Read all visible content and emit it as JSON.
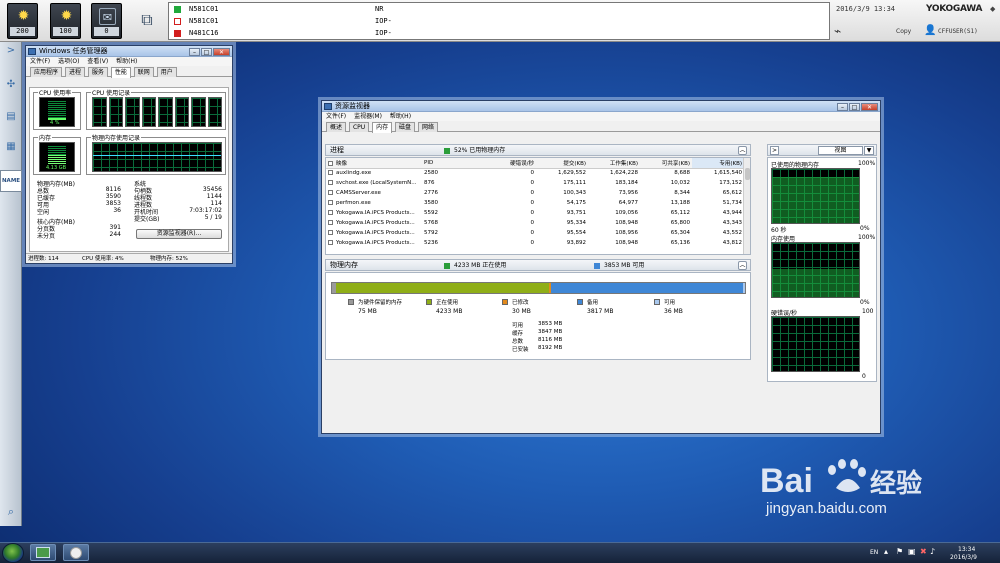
{
  "topbar": {
    "buttons": [
      {
        "icon": "sun-alarm-icon",
        "count": "200"
      },
      {
        "icon": "sun-alarm-icon",
        "count": "100"
      },
      {
        "icon": "message-icon",
        "count": "0"
      }
    ],
    "alarms": [
      {
        "tag": "N581C01",
        "value": "NR",
        "color": "#1fa83a"
      },
      {
        "tag": "N581C01",
        "value": "IOP-",
        "color": "#d21e1e"
      },
      {
        "tag": "N481C16",
        "value": "IOP-",
        "color": "#d21e1e"
      }
    ],
    "datetime": "2016/3/9  13:34",
    "brand": "YOKOGAWA",
    "copy_label": "Copy",
    "user": "CFFUSER(S1)"
  },
  "sidebar": {
    "name_label": "NAME"
  },
  "taskmgr": {
    "title": "Windows 任务管理器",
    "menu": [
      "文件(F)",
      "选项(O)",
      "查看(V)",
      "帮助(H)"
    ],
    "tabs": [
      "应用程序",
      "进程",
      "服务",
      "性能",
      "联网",
      "用户"
    ],
    "active_tab": 3,
    "cpu_usage_label": "CPU 使用率",
    "cpu_usage_value": "4 %",
    "cpu_history_label": "CPU 使用记录",
    "memory_label": "内存",
    "memory_value": "4.13 GB",
    "mem_history_label": "物理内存使用记录",
    "physical_label": "物理内存(MB)",
    "physical": [
      {
        "k": "总数",
        "v": "8116"
      },
      {
        "k": "已缓存",
        "v": "3590"
      },
      {
        "k": "可用",
        "v": "3853"
      },
      {
        "k": "空闲",
        "v": "36"
      }
    ],
    "kernel_label": "核心内存(MB)",
    "kernel": [
      {
        "k": "分页数",
        "v": "391"
      },
      {
        "k": "未分页",
        "v": "244"
      }
    ],
    "system_label": "系统",
    "system": [
      {
        "k": "句柄数",
        "v": "35456"
      },
      {
        "k": "线程数",
        "v": "1144"
      },
      {
        "k": "进程数",
        "v": "114"
      },
      {
        "k": "开机时间",
        "v": "7:03:17:02"
      },
      {
        "k": "提交(GB)",
        "v": "5 / 19"
      }
    ],
    "resmon_button": "资源监视器(R)...",
    "status": [
      "进程数: 114",
      "CPU 使用率: 4%",
      "物理内存: 52%"
    ]
  },
  "resmon": {
    "title": "资源监视器",
    "menu": [
      "文件(F)",
      "监视器(M)",
      "帮助(H)"
    ],
    "tabs": [
      "概述",
      "CPU",
      "内存",
      "磁盘",
      "网络"
    ],
    "active_tab": 2,
    "process_section": "进程",
    "process_summary": "52% 已用物理内存",
    "columns": [
      "映像",
      "PID",
      "硬错误/秒",
      "提交(KB)",
      "工作集(KB)",
      "可共享(KB)",
      "专用(KB)"
    ],
    "rows": [
      [
        "auxlindg.exe",
        "2580",
        "0",
        "1,629,552",
        "1,624,228",
        "8,688",
        "1,615,540"
      ],
      [
        "svchost.exe (LocalSystemN...",
        "876",
        "0",
        "175,111",
        "183,184",
        "10,032",
        "173,152"
      ],
      [
        "CAMSServer.exe",
        "2776",
        "0",
        "100,343",
        "73,956",
        "8,344",
        "65,612"
      ],
      [
        "perfmon.exe",
        "3580",
        "0",
        "54,175",
        "64,977",
        "13,188",
        "51,734"
      ],
      [
        "Yokogawa.IA.iPCS Products...",
        "5592",
        "0",
        "93,751",
        "109,056",
        "65,112",
        "43,944"
      ],
      [
        "Yokogawa.IA.iPCS Products...",
        "5768",
        "0",
        "95,334",
        "108,948",
        "65,800",
        "43,343"
      ],
      [
        "Yokogawa.IA.iPCS Products...",
        "5792",
        "0",
        "95,554",
        "108,956",
        "65,304",
        "43,552"
      ],
      [
        "Yokogawa.IA.iPCS Products...",
        "5236",
        "0",
        "93,892",
        "108,948",
        "65,136",
        "43,812"
      ]
    ],
    "memory_section": "物理内存",
    "memory_inuse_summary": "4233 MB 正在使用",
    "memory_avail_summary": "3853 MB 可用",
    "bar": [
      {
        "name": "为硬件保留的内存",
        "mb": 75,
        "color": "#9a9a9a"
      },
      {
        "name": "正在使用",
        "mb": 4233,
        "color": "#8fae17"
      },
      {
        "name": "已修改",
        "mb": 30,
        "color": "#e38a1c"
      },
      {
        "name": "备用",
        "mb": 3817,
        "color": "#3f87d6"
      },
      {
        "name": "可用",
        "mb": 36,
        "color": "#a9c8ee"
      }
    ],
    "legend": [
      {
        "label": "为硬件保留的内存",
        "value": "75 MB",
        "color": "#9a9a9a"
      },
      {
        "label": "正在使用",
        "value": "4233 MB",
        "color": "#8fae17"
      },
      {
        "label": "已修改",
        "value": "30 MB",
        "color": "#e38a1c"
      },
      {
        "label": "备用",
        "value": "3817 MB",
        "color": "#3f87d6"
      },
      {
        "label": "可用",
        "value": "36 MB",
        "color": "#a9c8ee"
      }
    ],
    "stats": [
      {
        "k": "可用",
        "v": "3853 MB"
      },
      {
        "k": "缓存",
        "v": "3847 MB"
      },
      {
        "k": "总数",
        "v": "8116 MB"
      },
      {
        "k": "已安装",
        "v": "8192 MB"
      }
    ],
    "views_button": "视图",
    "graph1_title": "已使用的物理内存",
    "graph1_max": "100%",
    "graph1_foot": "60 秒",
    "graph1_min": "0%",
    "graph2_title": "内存使用",
    "graph2_max": "100%",
    "graph2_min": "0%",
    "graph3_title": "硬错误/秒",
    "graph3_max": "100",
    "graph3_min": "0"
  },
  "taskbar": {
    "time": "13:34",
    "date": "2016/3/9",
    "lang": "EN"
  },
  "watermark": "jingyan.baidu.com"
}
